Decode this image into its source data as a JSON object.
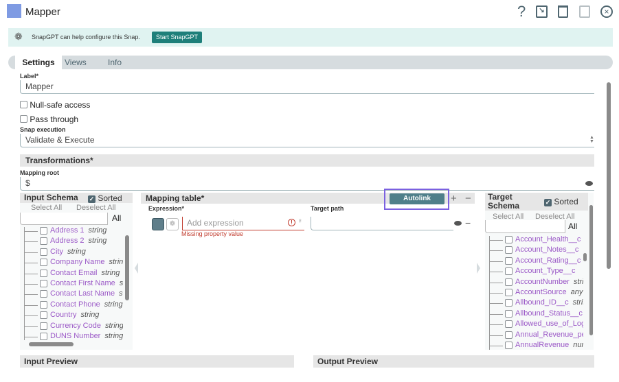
{
  "window": {
    "title": "Mapper",
    "icon_color": "#7f9be3"
  },
  "toolbar": {
    "help": "?",
    "export": "⧉",
    "delete": "🗑",
    "save": "🖫",
    "close": "⊗"
  },
  "banner": {
    "text": "SnapGPT can help configure this Snap.",
    "button": "Start SnapGPT"
  },
  "tabs": [
    {
      "label": "Settings",
      "active": true
    },
    {
      "label": "Views"
    },
    {
      "label": "Info"
    }
  ],
  "settings": {
    "label_label": "Label*",
    "label_value": "Mapper",
    "null_safe": "Null-safe access",
    "pass_through": "Pass through",
    "snap_exec_label": "Snap execution",
    "snap_exec_value": "Validate & Execute",
    "transformations": "Transformations*",
    "mapping_root_label": "Mapping root",
    "mapping_root_value": "$"
  },
  "input_schema": {
    "title": "Input Schema",
    "sorted": "Sorted",
    "select_all": "Select All",
    "deselect_all": "Deselect All",
    "filter": "All",
    "items": [
      {
        "name": "Address 1",
        "type": "string"
      },
      {
        "name": "Address 2",
        "type": "string"
      },
      {
        "name": "City",
        "type": "string"
      },
      {
        "name": "Company Name",
        "type": "string"
      },
      {
        "name": "Contact Email",
        "type": "string"
      },
      {
        "name": "Contact First Name",
        "type": "string"
      },
      {
        "name": "Contact Last Name",
        "type": "string"
      },
      {
        "name": "Contact Phone",
        "type": "string"
      },
      {
        "name": "Country",
        "type": "string"
      },
      {
        "name": "Currency Code",
        "type": "string"
      },
      {
        "name": "DUNS Number",
        "type": "string"
      }
    ]
  },
  "mapping_table": {
    "title": "Mapping table*",
    "autolink": "Autolink",
    "add": "+",
    "remove": "−",
    "expression_label": "Expression*",
    "target_label": "Target path",
    "expression_placeholder": "Add expression",
    "error": "Missing property value",
    "highlight_color": "#7b61e0"
  },
  "target_schema": {
    "title": "Target Schema",
    "sorted": "Sorted",
    "select_all": "Select All",
    "deselect_all": "Deselect All",
    "filter": "All",
    "items": [
      {
        "name": "Account_Health__c",
        "type": ""
      },
      {
        "name": "Account_Notes__c",
        "type": ""
      },
      {
        "name": "Account_Rating__c",
        "type": ""
      },
      {
        "name": "Account_Type__c",
        "type": ""
      },
      {
        "name": "AccountNumber",
        "type": "string"
      },
      {
        "name": "AccountSource",
        "type": "any"
      },
      {
        "name": "Allbound_ID__c",
        "type": "string"
      },
      {
        "name": "Allbound_Status__c",
        "type": ""
      },
      {
        "name": "Allowed_use_of_Logo__c",
        "type": ""
      },
      {
        "name": "Annual_Revenue_per_Employee__c",
        "type": ""
      },
      {
        "name": "AnnualRevenue",
        "type": "number"
      }
    ]
  },
  "previews": {
    "input": "Input Preview",
    "output": "Output Preview"
  }
}
